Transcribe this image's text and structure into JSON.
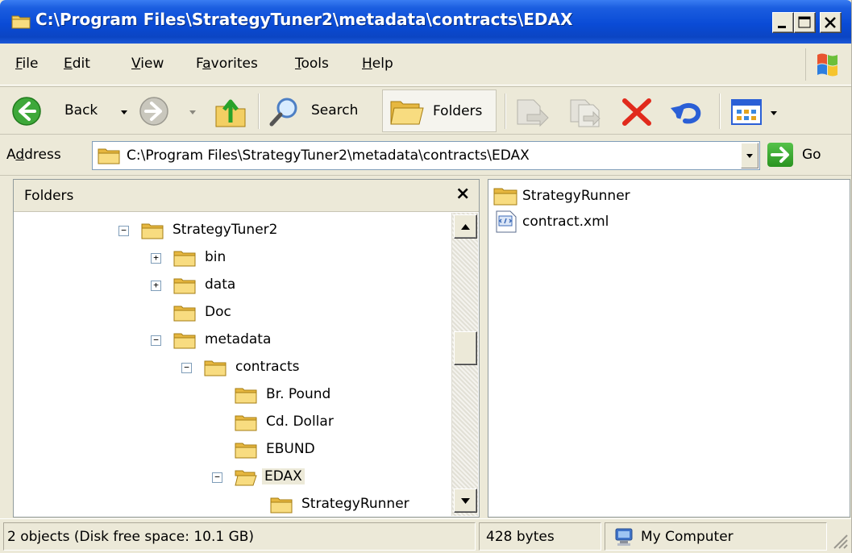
{
  "window": {
    "title": "C:\\Program Files\\StrategyTuner2\\metadata\\contracts\\EDAX",
    "title_icon": "folder-icon",
    "accent": "#0a4bd6"
  },
  "menu": [
    {
      "label": "File",
      "key": "F"
    },
    {
      "label": "Edit",
      "key": "E"
    },
    {
      "label": "View",
      "key": "V"
    },
    {
      "label": "Favorites",
      "key": "a"
    },
    {
      "label": "Tools",
      "key": "T"
    },
    {
      "label": "Help",
      "key": "H"
    }
  ],
  "toolbar": {
    "back_label": "Back",
    "search_label": "Search",
    "folders_label": "Folders",
    "icons": [
      "back-arrow-icon",
      "forward-arrow-icon",
      "up-folder-icon",
      "search-icon",
      "folders-icon",
      "move-to-icon",
      "copy-to-icon",
      "delete-icon",
      "undo-icon",
      "views-icon"
    ]
  },
  "address": {
    "label": "Address",
    "value": "C:\\Program Files\\StrategyTuner2\\metadata\\contracts\\EDAX",
    "go_label": "Go"
  },
  "folders_pane": {
    "title": "Folders",
    "close_glyph": "×",
    "tree": [
      {
        "label": "StrategyTuner2",
        "expander": "−"
      },
      {
        "label": "bin",
        "expander": "+"
      },
      {
        "label": "data",
        "expander": "+"
      },
      {
        "label": "Doc",
        "expander": ""
      },
      {
        "label": "metadata",
        "expander": "−"
      },
      {
        "label": "contracts",
        "expander": "−"
      },
      {
        "label": "Br. Pound",
        "expander": ""
      },
      {
        "label": "Cd. Dollar",
        "expander": ""
      },
      {
        "label": "EBUND",
        "expander": ""
      },
      {
        "label": "EDAX",
        "expander": "−",
        "selected": true
      },
      {
        "label": "StrategyRunner",
        "expander": ""
      }
    ]
  },
  "content": {
    "items": [
      {
        "label": "StrategyRunner",
        "icon": "folder-icon"
      },
      {
        "label": "contract.xml",
        "icon": "xml-file-icon"
      }
    ]
  },
  "status": {
    "objects": "2 objects (Disk free space: 10.1 GB)",
    "size": "428 bytes",
    "zone": "My Computer"
  }
}
